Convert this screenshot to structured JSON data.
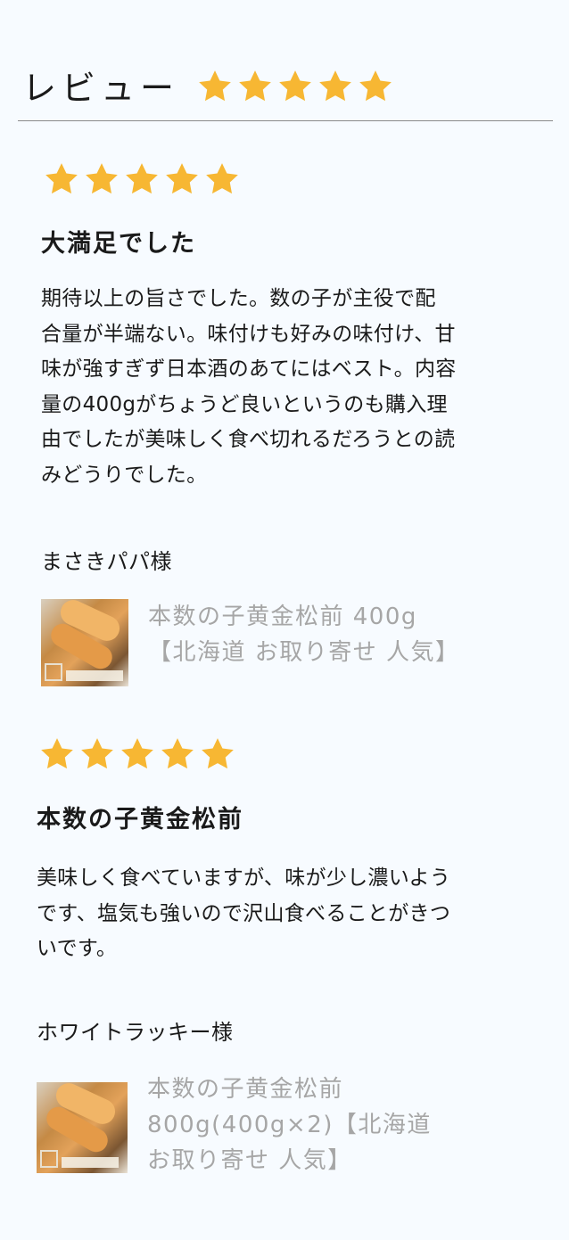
{
  "header": {
    "title": "レビュー",
    "rating": 5,
    "star_color": "#f7b733"
  },
  "reviews": [
    {
      "rating": 5,
      "title": "大満足でした",
      "body": "期待以上の旨さでした。数の子が主役で配\n合量が半端ない。味付けも好みの味付け、甘\n味が強すぎず日本酒のあてにはベスト。内容\n量の400gがちょうど良いというのも購入理\n由でしたが美味しく食べ切れるだろうとの読\nみどうりでした。",
      "reviewer": "まさきパパ様",
      "product_name": "本数の子黄金松前 400g\n【北海道 お取り寄せ 人気】"
    },
    {
      "rating": 5,
      "title": "本数の子黄金松前",
      "body": "美味しく食べていますが、味が少し濃いよう\nです、塩気も強いので沢山食べることがきつ\nいです。",
      "reviewer": "ホワイトラッキー様",
      "product_name": "本数の子黄金松前\n800g(400g×2)【北海道\nお取り寄せ 人気】"
    }
  ]
}
